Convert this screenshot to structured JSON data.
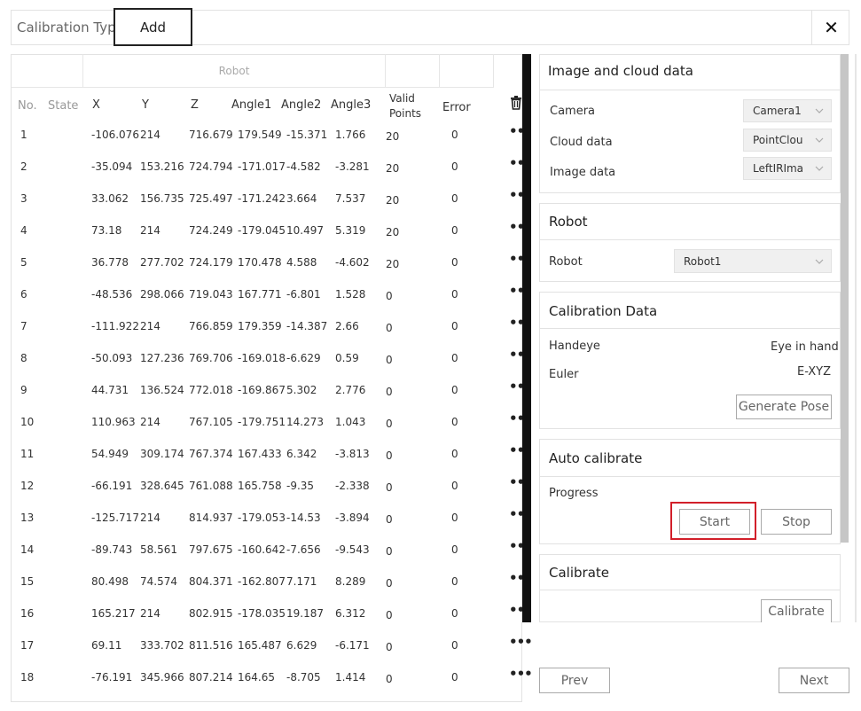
{
  "top": {
    "calibration_type_label": "Calibration Type",
    "add_label": "Add",
    "close_glyph": "✕"
  },
  "table": {
    "group_header": "Robot",
    "headers": {
      "no": "No.",
      "state": "State",
      "x": "X",
      "y": "Y",
      "z": "Z",
      "angle1": "Angle1",
      "angle2": "Angle2",
      "angle3": "Angle3",
      "valid_1": "Valid",
      "valid_2": "Points",
      "error": "Error"
    },
    "more_glyph": "•••",
    "rows": [
      [
        "1",
        "-106.076",
        "214",
        "716.679",
        "179.549",
        "-15.371",
        "1.766",
        "20",
        "0"
      ],
      [
        "2",
        "-35.094",
        "153.216",
        "724.794",
        "-171.017",
        "-4.582",
        "-3.281",
        "20",
        "0"
      ],
      [
        "3",
        "33.062",
        "156.735",
        "725.497",
        "-171.242",
        "3.664",
        "7.537",
        "20",
        "0"
      ],
      [
        "4",
        "73.18",
        "214",
        "724.249",
        "-179.045",
        "10.497",
        "5.319",
        "20",
        "0"
      ],
      [
        "5",
        "36.778",
        "277.702",
        "724.179",
        "170.478",
        "4.588",
        "-4.602",
        "20",
        "0"
      ],
      [
        "6",
        "-48.536",
        "298.066",
        "719.043",
        "167.771",
        "-6.801",
        "1.528",
        "0",
        "0"
      ],
      [
        "7",
        "-111.922",
        "214",
        "766.859",
        "179.359",
        "-14.387",
        "2.66",
        "0",
        "0"
      ],
      [
        "8",
        "-50.093",
        "127.236",
        "769.706",
        "-169.018",
        "-6.629",
        "0.59",
        "0",
        "0"
      ],
      [
        "9",
        "44.731",
        "136.524",
        "772.018",
        "-169.867",
        "5.302",
        "2.776",
        "0",
        "0"
      ],
      [
        "10",
        "110.963",
        "214",
        "767.105",
        "-179.751",
        "14.273",
        "1.043",
        "0",
        "0"
      ],
      [
        "11",
        "54.949",
        "309.174",
        "767.374",
        "167.433",
        "6.342",
        "-3.813",
        "0",
        "0"
      ],
      [
        "12",
        "-66.191",
        "328.645",
        "761.088",
        "165.758",
        "-9.35",
        "-2.338",
        "0",
        "0"
      ],
      [
        "13",
        "-125.717",
        "214",
        "814.937",
        "-179.053",
        "-14.53",
        "-3.894",
        "0",
        "0"
      ],
      [
        "14",
        "-89.743",
        "58.561",
        "797.675",
        "-160.642",
        "-7.656",
        "-9.543",
        "0",
        "0"
      ],
      [
        "15",
        "80.498",
        "74.574",
        "804.371",
        "-162.807",
        "7.171",
        "8.289",
        "0",
        "0"
      ],
      [
        "16",
        "165.217",
        "214",
        "802.915",
        "-178.035",
        "19.187",
        "6.312",
        "0",
        "0"
      ],
      [
        "17",
        "69.11",
        "333.702",
        "811.516",
        "165.487",
        "6.629",
        "-6.171",
        "0",
        "0"
      ],
      [
        "18",
        "-76.191",
        "345.966",
        "807.214",
        "164.65",
        "-8.705",
        "1.414",
        "0",
        "0"
      ]
    ]
  },
  "panel": {
    "image_cloud": {
      "title": "Image and cloud data",
      "camera_label": "Camera",
      "camera_value": "Camera1",
      "cloud_label": "Cloud data",
      "cloud_value": "PointClou",
      "image_label": "Image data",
      "image_value": "LeftIRIma"
    },
    "robot": {
      "title": "Robot",
      "robot_label": "Robot",
      "robot_value": "Robot1"
    },
    "calibration_data": {
      "title": "Calibration Data",
      "handeye_label": "Handeye",
      "handeye_value": "Eye in hand",
      "euler_label": "Euler",
      "euler_value": "E-XYZ",
      "generate_pose_label": "Generate Pose"
    },
    "auto_calibrate": {
      "title": "Auto calibrate",
      "progress_label": "Progress",
      "start_label": "Start",
      "stop_label": "Stop"
    },
    "calibrate": {
      "title": "Calibrate",
      "calibrate_label": "Calibrate"
    }
  },
  "footer": {
    "prev_label": "Prev",
    "next_label": "Next"
  },
  "colors": {
    "highlight": "#d21f2a",
    "divider": "#111111"
  }
}
